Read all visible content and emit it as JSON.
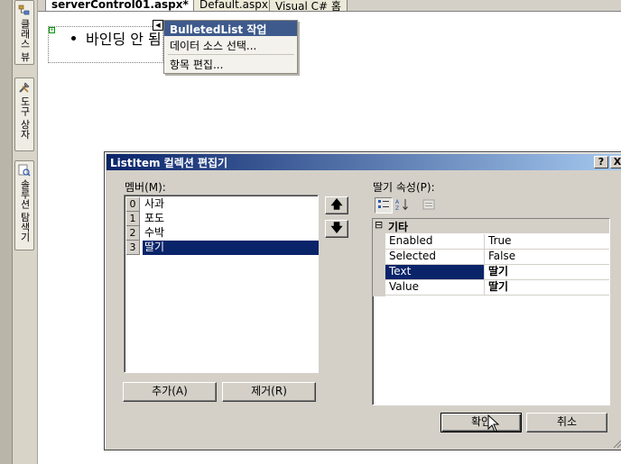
{
  "left_dock": {
    "tabs": [
      {
        "label": "클래스 뷰",
        "icon": "class-view-icon"
      },
      {
        "label": "도구 상자",
        "icon": "toolbox-icon"
      },
      {
        "label": "솔루션 탐색기",
        "icon": "solution-explorer-icon"
      }
    ]
  },
  "doc_tabs": [
    {
      "label": "serverControl01.aspx*",
      "active": true
    },
    {
      "label": "Default.aspx",
      "active": false
    },
    {
      "label": "Visual C# 홈",
      "active": false
    }
  ],
  "design": {
    "bullet_text": "바인딩 안 됨"
  },
  "smart_tag": {
    "title": "BulletedList 작업",
    "links": [
      "데이터 소스 선택...",
      "항목 편집..."
    ]
  },
  "dialog": {
    "title": "ListItem 컬렉션 편집기",
    "help_button": "?",
    "close_button": "X",
    "members_label": "멤버(M):",
    "members": [
      {
        "index": "0",
        "value": "사과"
      },
      {
        "index": "1",
        "value": "포도"
      },
      {
        "index": "2",
        "value": "수박"
      },
      {
        "index": "3",
        "value": "딸기",
        "selected": true
      }
    ],
    "move_up_glyph": "🡅",
    "move_down_glyph": "🡇",
    "add_button": "추가(A)",
    "remove_button": "제거(R)",
    "properties_label": "딸기 속성(P):",
    "property_category": "기타",
    "category_toggle": "⊟",
    "properties": [
      {
        "name": "Enabled",
        "value": "True"
      },
      {
        "name": "Selected",
        "value": "False"
      },
      {
        "name": "Text",
        "value": "딸기",
        "selected": true
      },
      {
        "name": "Value",
        "value": "딸기"
      }
    ],
    "ok_button": "확인",
    "cancel_button": "취소"
  },
  "colors": {
    "selection": "#0a246a",
    "dialog_face": "#d4d0c8",
    "titlebar_start": "#0a246a",
    "titlebar_end": "#a6caf0"
  }
}
